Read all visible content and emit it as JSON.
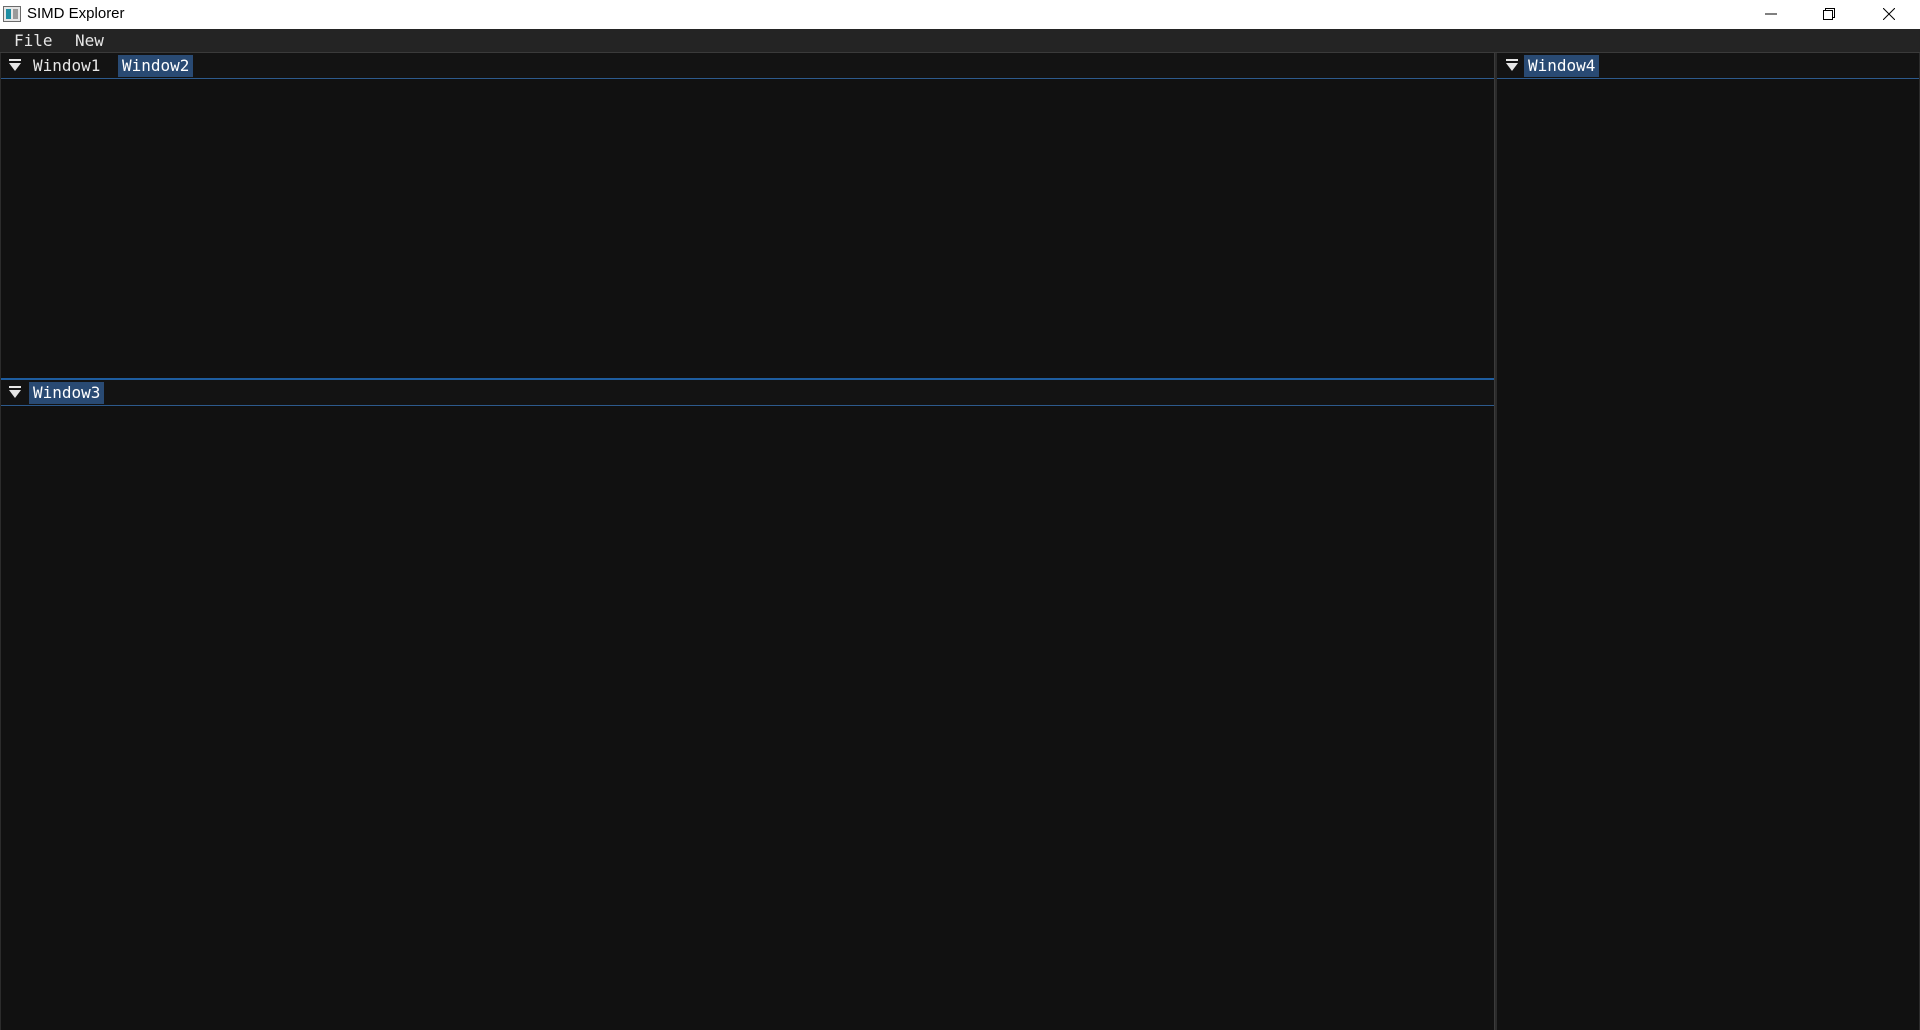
{
  "window": {
    "title": "SIMD Explorer",
    "icon": "app-window-icon",
    "controls": {
      "minimize_icon": "minimize-icon",
      "restore_icon": "restore-icon",
      "close_icon": "close-icon"
    }
  },
  "menu": {
    "items": [
      {
        "label": "File"
      },
      {
        "label": "New"
      }
    ]
  },
  "docks": {
    "top_left": {
      "menu_icon": "dock-menu-icon",
      "tabs": [
        {
          "label": "Window1",
          "active": false
        },
        {
          "label": "Window2",
          "active": true
        }
      ]
    },
    "bottom_left": {
      "menu_icon": "dock-menu-icon",
      "tabs": [
        {
          "label": "Window3",
          "active": true
        }
      ]
    },
    "right": {
      "menu_icon": "dock-menu-icon",
      "tabs": [
        {
          "label": "Window4",
          "active": true
        }
      ]
    }
  },
  "colors": {
    "background": "#0f0f0f",
    "menu_bar": "#242424",
    "active_tab": "#294a73",
    "tab_underline": "#2d5a8c",
    "focus_splitter": "#1e5da0",
    "text": "#e6e6e6"
  }
}
